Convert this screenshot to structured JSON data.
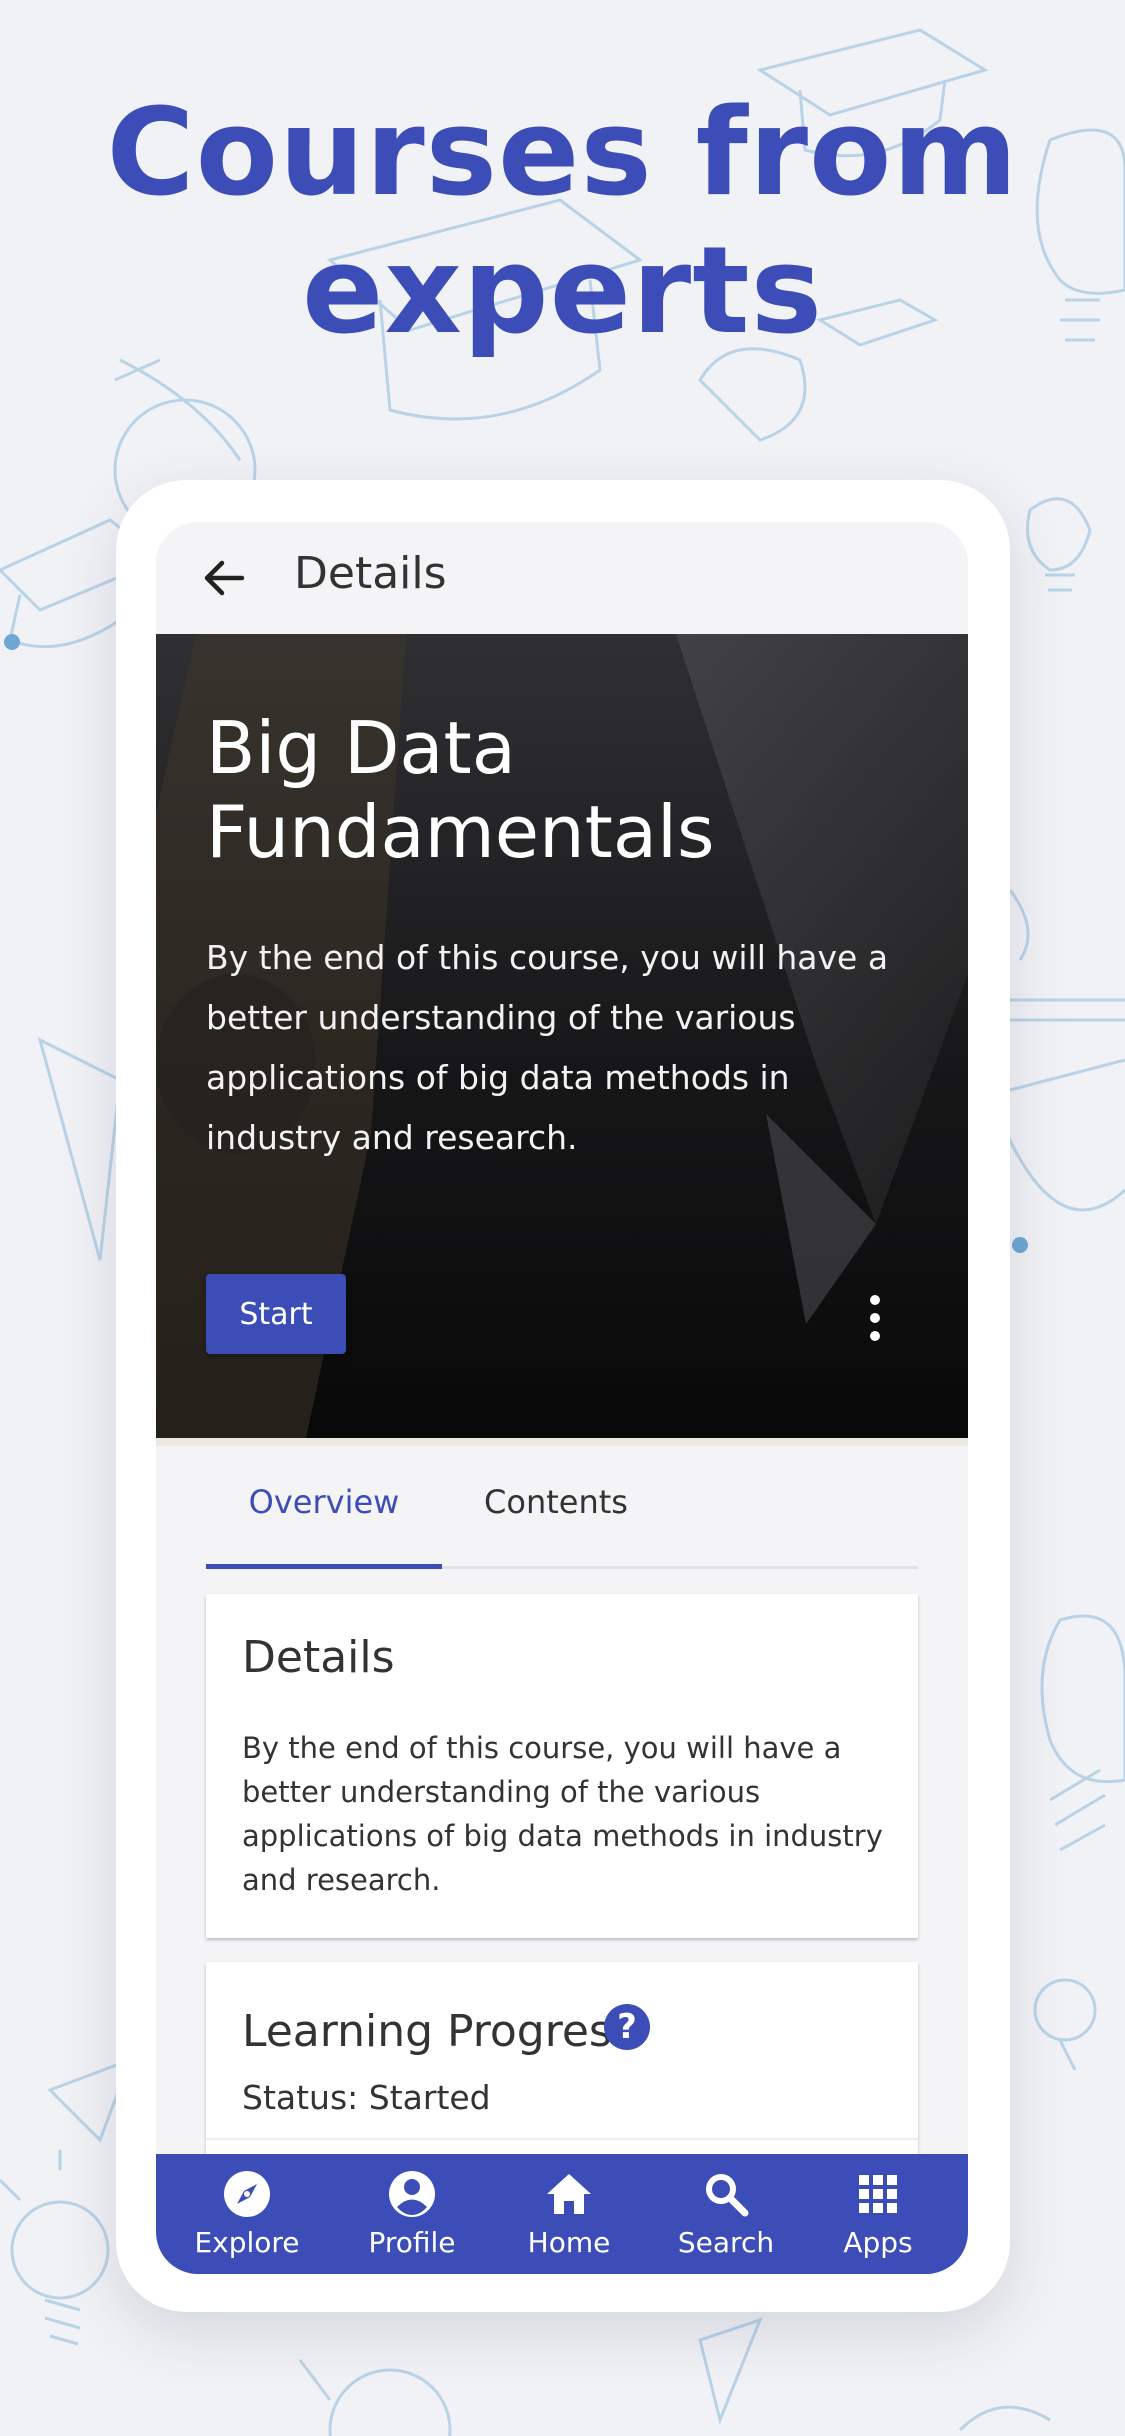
{
  "promo": {
    "headline_line1": "Courses from",
    "headline_line2": "experts"
  },
  "appbar": {
    "back_icon": "arrow-left-icon",
    "title": "Details"
  },
  "hero": {
    "title_line1": "Big Data",
    "title_line2": "Fundamentals",
    "description": "By the end of this course, you will have a better understanding of the various applications of big data methods in industry and research.",
    "start_label": "Start",
    "more_icon": "more-vertical-icon"
  },
  "tabs": [
    {
      "label": "Overview",
      "active": true
    },
    {
      "label": "Contents",
      "active": false
    }
  ],
  "details_card": {
    "title": "Details",
    "body": "By the end of this course, you will have a better understanding of the various applications of big data methods in industry and research."
  },
  "progress_card": {
    "title": "Learning Progress",
    "help_icon": "help-circle-icon",
    "help_glyph": "?",
    "status": "Status: Started"
  },
  "bottom_nav": [
    {
      "label": "Explore",
      "icon": "compass-icon"
    },
    {
      "label": "Profile",
      "icon": "account-circle-icon"
    },
    {
      "label": "Home",
      "icon": "home-icon"
    },
    {
      "label": "Search",
      "icon": "search-icon"
    },
    {
      "label": "Apps",
      "icon": "apps-grid-icon"
    }
  ],
  "colors": {
    "accent": "#3d4db7",
    "background": "#f1f2f5",
    "doodle": "#b9d3e6"
  }
}
